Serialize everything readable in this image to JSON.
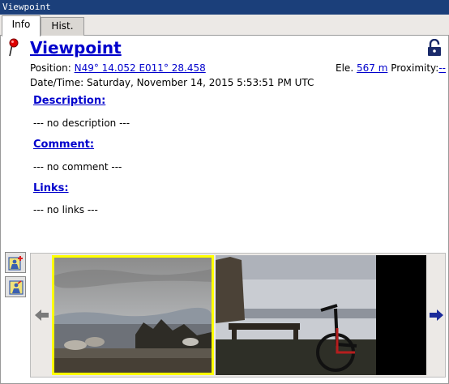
{
  "window": {
    "title": "Viewpoint"
  },
  "tabs": [
    {
      "label": "Info"
    },
    {
      "label": "Hist."
    }
  ],
  "waypoint": {
    "name": "Viewpoint",
    "position_label": "Position:",
    "position_value": "N49° 14.052 E011° 28.458",
    "elevation_label": "Ele.",
    "elevation_value": "567 m",
    "proximity_label": "Proximity:",
    "proximity_value": "--",
    "datetime": "Date/Time: Saturday, November 14, 2015 5:53:51 PM UTC"
  },
  "sections": {
    "description": {
      "heading": "Description:",
      "text": "--- no description ---"
    },
    "comment": {
      "heading": "Comment:",
      "text": "--- no comment ---"
    },
    "links": {
      "heading": "Links:",
      "text": "--- no links ---"
    }
  },
  "icons": {
    "flag": "red-pin-icon",
    "lock": "lock-open-icon",
    "add_photo": "add-photo-icon",
    "photo_info": "photo-info-icon",
    "prev": "arrow-left-icon",
    "next": "arrow-right-icon"
  },
  "colors": {
    "link": "#0000cc",
    "selection": "#ffff00",
    "titlebar": "#1b3f7a"
  }
}
